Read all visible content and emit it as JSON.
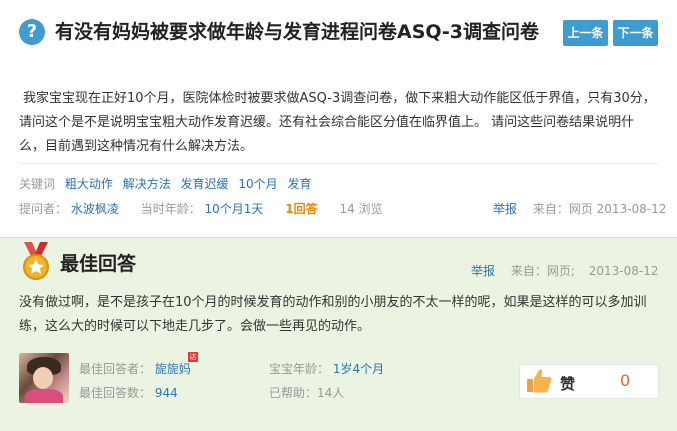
{
  "question": {
    "title": "有没有妈妈被要求做年龄与发育进程问卷ASQ-3调查问卷",
    "body": "我家宝宝现在正好10个月，医院体检时被要求做ASQ-3调查问卷，做下来粗大动作能区低于界值，只有30分，请问这个是不是说明宝宝粗大动作发育迟缓。还有社会综合能区分值在临界值上。 请问这些问卷结果说明什么，目前遇到这种情况有什么解决方法。",
    "icon": "question-icon",
    "nav": {
      "prev": "上一条",
      "next": "下一条"
    },
    "keywords_label": "关键词",
    "keywords": [
      "粗大动作",
      "解决方法",
      "发育迟缓",
      "10个月",
      "发育"
    ],
    "asker_label": "提问者：",
    "asker": "水波枫凌",
    "age_label": "当时年龄：",
    "age": "10个月1天",
    "answers": "1回答",
    "views": "14 浏览",
    "report": "举报",
    "source": "来自：网页 2013-08-12"
  },
  "best_answer": {
    "title": "最佳回答",
    "report": "举报",
    "source": "来自：网页;",
    "date": "2013-08-12",
    "body": "没有做过啊，是不是孩子在10个月的时候发育的动作和别的小朋友的不太一样的呢，如果是这样的可以多加训练，这么大的时候可以下地走几步了。会做一些再见的动作。",
    "answerer_label": "最佳回答者：",
    "answerer": "旎旎妈",
    "answer_count_label": "最佳回答数：",
    "answer_count": "944",
    "baby_age_label": "宝宝年龄：",
    "baby_age": "1岁4个月",
    "helped": "已帮助：14人",
    "like_label": "赞",
    "like_count": "0",
    "badge": "达"
  },
  "colors": {
    "accent": "#3f9cd0",
    "link": "#2b74b3",
    "orange": "#e8860c",
    "answer_bg": "#ebf3e2",
    "like": "#e5632e"
  }
}
